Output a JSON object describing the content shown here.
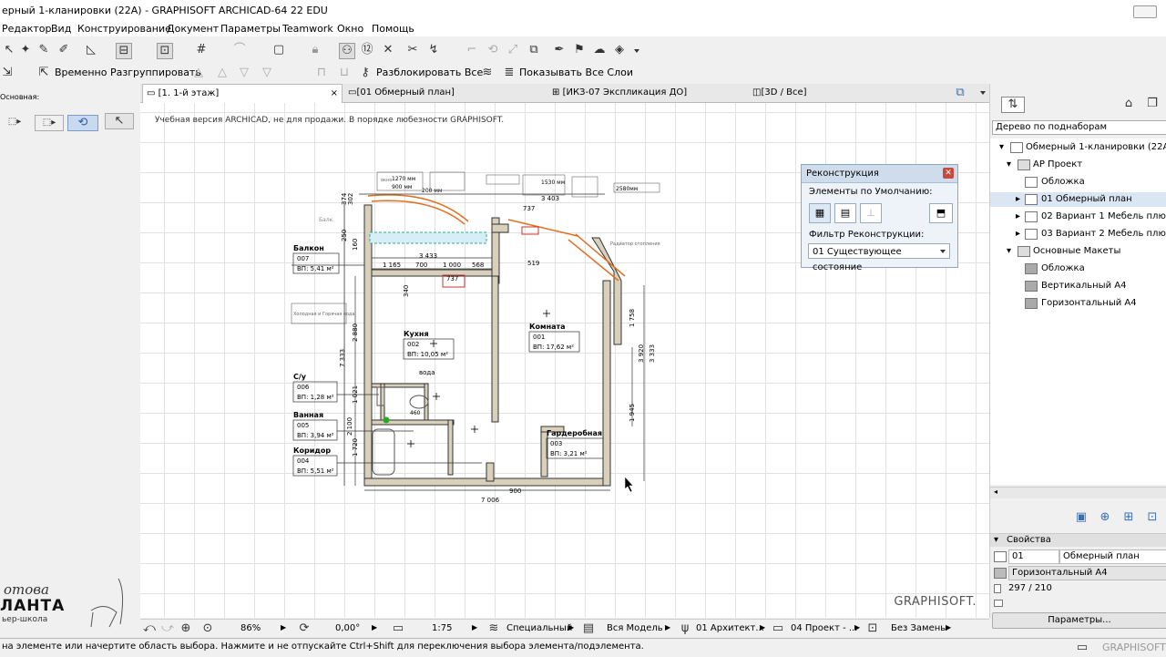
{
  "window": {
    "title": "ерный 1-кланировки (22A) - GRAPHISOFT ARCHICAD-64 22 EDU"
  },
  "menu": [
    "Редактор",
    "Вид",
    "Конструирование",
    "Документ",
    "Параметры",
    "Teamwork",
    "Окно",
    "Помощь"
  ],
  "toolbar2": {
    "ungroup_label": "Временно Разгруппировать",
    "unlock_all_label": "Разблокировать Все",
    "show_layers_label": "Показывать Все Слои"
  },
  "toolbox": {
    "label": "Основная:"
  },
  "tabs": [
    {
      "label": "[1. 1-й этаж]",
      "active": true,
      "close": "×"
    },
    {
      "label": "[01 Обмерный план]"
    },
    {
      "label": "[ИКЗ-07 Экспликация ДО]"
    },
    {
      "label": "[3D / Все]"
    }
  ],
  "canvas": {
    "watermark": "Учебная версия ARCHICAD, не для продажи. В порядке любезности GRAPHISOFT.",
    "brand": "GRAPHISOFT.",
    "rooms": [
      {
        "name": "Балкон",
        "num": "007",
        "area": "ВП: 5,41 м²"
      },
      {
        "name": "Кухня",
        "num": "002",
        "area": "ВП: 10,05 м²"
      },
      {
        "name": "Комната",
        "num": "001",
        "area": "ВП: 17,62 м²"
      },
      {
        "name": "С/у",
        "num": "006",
        "area": "ВП: 1,28 м²"
      },
      {
        "name": "Ванная",
        "num": "005",
        "area": "ВП: 3,94 м²"
      },
      {
        "name": "Коридор",
        "num": "004",
        "area": "ВП: 5,51 м²"
      },
      {
        "name": "Гардеробная",
        "num": "003",
        "area": "ВП: 3,21 м²"
      }
    ],
    "dims": {
      "d3403": "3 403",
      "d3433": "3 433",
      "d1165": "1 165",
      "d700": "700",
      "d1000": "1 000",
      "d568": "568",
      "d737a": "737",
      "d737b": "737",
      "d519": "519",
      "d7006": "7 006",
      "d900": "900",
      "d1758": "1 758",
      "d3920": "3 920",
      "d3333": "3 333",
      "d1945": "1 945",
      "d7333": "7 333",
      "d2880": "2 880",
      "d1021": "1 021",
      "d2100": "2 100",
      "d1720": "1 720",
      "d340": "340",
      "d460": "460",
      "d374": "374",
      "d302": "302",
      "d250": "250",
      "d160": "160",
      "d200": "200 мм",
      "d1270": "1270 мм",
      "d900mm": "900 мм",
      "d1530": "1530 мм",
      "d2580": "2580мм"
    },
    "notes": {
      "voda": "вода",
      "balc": "Балк",
      "radiator": "Радиатор отопления",
      "water_note": "Холодная и Горячая вода",
      "okno": "окно"
    }
  },
  "recon": {
    "title": "Реконструкция",
    "defaults_label": "Элементы по Умолчанию:",
    "filter_label": "Фильтр Реконструкции:",
    "filter_value": "01 Существующее состояние"
  },
  "navigator": {
    "dropdown": "Дерево по поднаборам",
    "tree": [
      {
        "label": "Обмерный 1-кланировки (22A)",
        "level": 0
      },
      {
        "label": "АР Проект",
        "level": 1
      },
      {
        "label": "Обложка",
        "level": 2
      },
      {
        "label": "01 Обмерный план",
        "level": 2,
        "selected": true
      },
      {
        "label": "02 Вариант 1 Мебель плюс во",
        "level": 2
      },
      {
        "label": "03 Вариант 2 Мебель плюс во",
        "level": 2
      },
      {
        "label": "Основные Макеты",
        "level": 1
      },
      {
        "label": "Обложка",
        "level": 2
      },
      {
        "label": "Вертикальный А4",
        "level": 2
      },
      {
        "label": "Горизонтальный А4",
        "level": 2
      }
    ],
    "props_title": "Свойства",
    "prop_num": "01",
    "prop_name": "Обмерный план",
    "prop_layout": "Горизонтальный А4",
    "prop_size": "297 / 210",
    "params_button": "Параметры..."
  },
  "bottombar": {
    "zoom": "86%",
    "angle": "0,00°",
    "scale": "1:75",
    "layer": "Специальный",
    "model": "Вся Модель",
    "arch": "01 Архитект...",
    "proj": "04 Проект - ...",
    "repl": "Без Замены"
  },
  "status": {
    "message": "на элементе или начертите область выбора. Нажмите и не отпускайте Ctrl+Shift для переключения выбора элемента/подэлемента.",
    "brand": "GRAPHISOFT"
  },
  "logo": {
    "line1": "отова",
    "line2": "ЛАНТА",
    "line3": "ьер-школа"
  }
}
